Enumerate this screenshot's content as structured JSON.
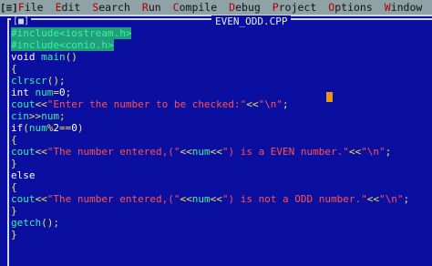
{
  "menubar": {
    "system_menu": "[≡]",
    "items": [
      {
        "hotkey": "F",
        "rest": "ile"
      },
      {
        "hotkey": "E",
        "rest": "dit"
      },
      {
        "hotkey": "S",
        "rest": "earch"
      },
      {
        "hotkey": "R",
        "rest": "un"
      },
      {
        "hotkey": "C",
        "rest": "ompile"
      },
      {
        "hotkey": "D",
        "rest": "ebug"
      },
      {
        "hotkey": "P",
        "rest": "roject"
      },
      {
        "hotkey": "O",
        "rest": "ptions"
      },
      {
        "hotkey": "W",
        "rest": "indow"
      }
    ]
  },
  "window": {
    "close_box": "[■]",
    "title": "EVEN_ODD.CPP"
  },
  "code": {
    "l1": "#include<iostream.h>",
    "l2": "#include<conio.h>",
    "l3a": "void ",
    "l3b": "main",
    "l3c": "()",
    "l4": "{",
    "l5a": "clrscr",
    "l5b": "();",
    "l6a": "int ",
    "l6b": "num",
    "l6c": "=",
    "l6d": "0",
    "l6e": ";",
    "l7a": "cout",
    "l7b": "<<",
    "l7c": "\"Enter the number to be checked:\"",
    "l7d": "<<",
    "l7e": "\"\\n\"",
    "l7f": ";",
    "l8a": "cin",
    "l8b": ">>",
    "l8c": "num",
    "l8d": ";",
    "l9a": "if",
    "l9b": "(",
    "l9c": "num",
    "l9d": "%",
    "l9e": "2",
    "l9f": "==",
    "l9g": "0",
    "l9h": ")",
    "l10": "{",
    "l11a": "cout",
    "l11b": "<<",
    "l11c": "\"The number entered,(\"",
    "l11d": "<<",
    "l11e": "num",
    "l11f": "<<",
    "l11g": "\") is a EVEN number.\"",
    "l11h": "<<",
    "l11i": "\"\\n\"",
    "l11j": ";",
    "l12": "}",
    "l13": "else",
    "l14": "{",
    "l15a": "cout",
    "l15b": "<<",
    "l15c": "\"The number entered,(\"",
    "l15d": "<<",
    "l15e": "num",
    "l15f": "<<",
    "l15g": "\") is not a ODD number.\"",
    "l15h": "<<",
    "l15i": "\"\\n\"",
    "l15j": ";",
    "l16": "}",
    "l17a": "getch",
    "l17b": "();",
    "l18": "}"
  }
}
